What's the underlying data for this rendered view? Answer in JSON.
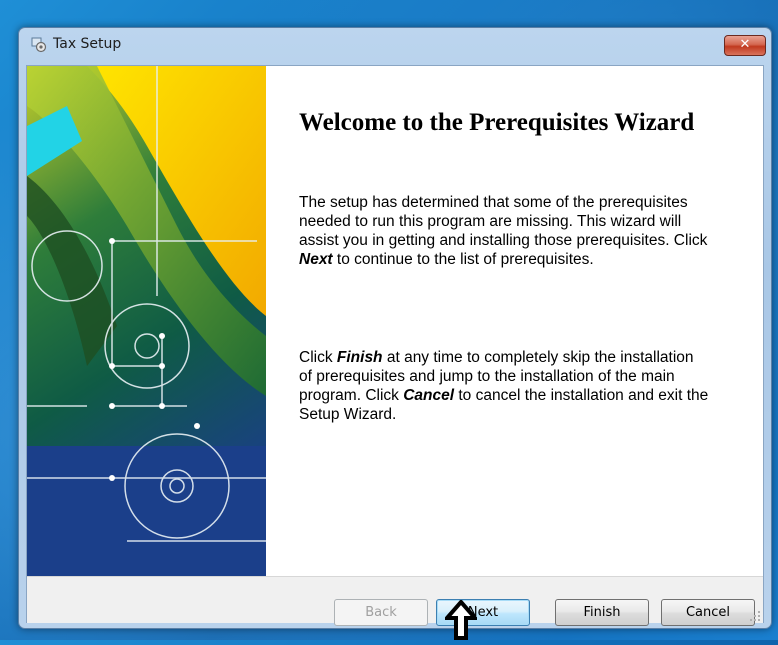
{
  "window": {
    "title": "Tax Setup",
    "close_glyph": "✕"
  },
  "icons": {
    "app": "setup-app-icon",
    "close": "close-icon",
    "pointer": "up-arrow-pointer-icon",
    "grip": "resize-grip-icon"
  },
  "welcome": {
    "title": "Welcome to the Prerequisites Wizard",
    "para1": {
      "a": "The setup has determined that some of the prerequisites needed to run this program are missing. This wizard will assist you in getting and installing those prerequisites. Click ",
      "em": "Next",
      "b": "  to continue to the list of prerequisites."
    },
    "para2": {
      "a": "Click ",
      "em1": "Finish",
      "b": " at any time to completely skip the installation of prerequisites and jump to the installation of the main program. Click ",
      "em2": "Cancel",
      "c": " to cancel the installation and exit the Setup Wizard."
    }
  },
  "buttons": {
    "back": "Back",
    "next": "Next",
    "finish": "Finish",
    "cancel": "Cancel"
  },
  "colors": {
    "desktop": "#1273bf",
    "default_button_border": "#3c7fb1",
    "close_button": "#c0391f"
  }
}
